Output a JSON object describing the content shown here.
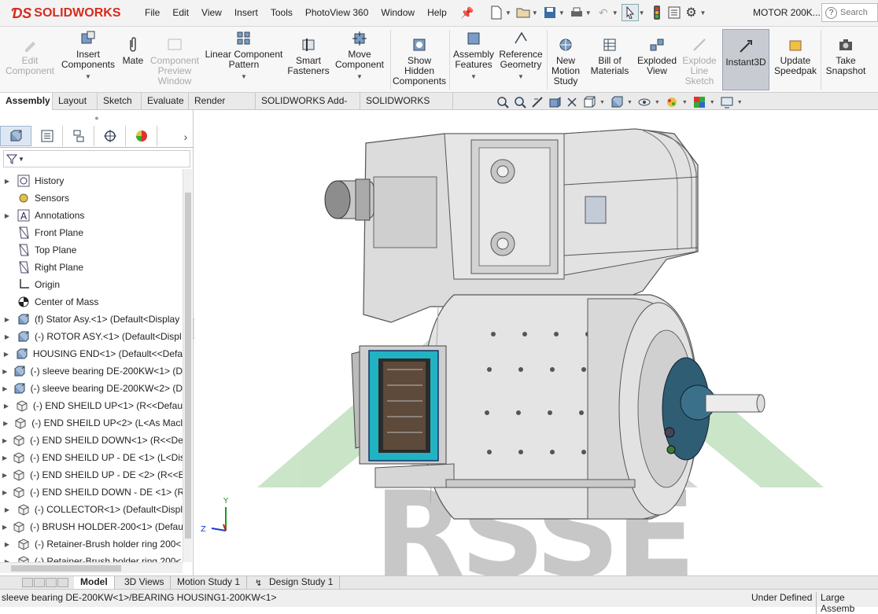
{
  "app": {
    "brand": "SOLIDWORKS",
    "doc_title": "MOTOR 200K...",
    "search_placeholder": "Search"
  },
  "menus": [
    "File",
    "Edit",
    "View",
    "Insert",
    "Tools",
    "PhotoView 360",
    "Window",
    "Help"
  ],
  "ribbon": {
    "edit_component": "Edit Component",
    "insert_components": "Insert Components",
    "mate": "Mate",
    "component_preview": "Component Preview Window",
    "linear_pattern": "Linear Component Pattern",
    "smart_fasteners": "Smart Fasteners",
    "move_component": "Move Component",
    "show_hidden": "Show Hidden Components",
    "assembly_features": "Assembly Features",
    "reference_geometry": "Reference Geometry",
    "new_motion_study": "New Motion Study",
    "bill_of_materials": "Bill of Materials",
    "exploded_view": "Exploded View",
    "explode_line_sketch": "Explode Line Sketch",
    "instant3d": "Instant3D",
    "update_speedpak": "Update Speedpak",
    "take_snapshot": "Take Snapshot"
  },
  "cmd_tabs": [
    "Assembly",
    "Layout",
    "Sketch",
    "Evaluate",
    "Render Tools",
    "SOLIDWORKS Add-Ins",
    "SOLIDWORKS MBD"
  ],
  "tree": [
    {
      "label": "History",
      "expand": true,
      "icon": "history-icon"
    },
    {
      "label": "Sensors",
      "expand": false,
      "icon": "sensors-icon"
    },
    {
      "label": "Annotations",
      "expand": true,
      "icon": "annotations-icon"
    },
    {
      "label": "Front Plane",
      "expand": false,
      "icon": "plane-icon"
    },
    {
      "label": "Top Plane",
      "expand": false,
      "icon": "plane-icon"
    },
    {
      "label": "Right Plane",
      "expand": false,
      "icon": "plane-icon"
    },
    {
      "label": "Origin",
      "expand": false,
      "icon": "origin-icon"
    },
    {
      "label": "Center of Mass",
      "expand": false,
      "icon": "center-of-mass-icon"
    },
    {
      "label": "(f) Stator Asy.<1> (Default<Display",
      "expand": true,
      "icon": "subassembly-icon"
    },
    {
      "label": "(-) ROTOR ASY.<1> (Default<Displ",
      "expand": true,
      "icon": "subassembly-icon"
    },
    {
      "label": "HOUSING END<1> (Default<<Defa",
      "expand": true,
      "icon": "subassembly-icon"
    },
    {
      "label": "(-) sleeve bearing DE-200KW<1> (D",
      "expand": true,
      "icon": "subassembly-icon"
    },
    {
      "label": "(-) sleeve bearing DE-200KW<2> (D",
      "expand": true,
      "icon": "subassembly-icon"
    },
    {
      "label": "(-) END SHEILD UP<1> (R<<Defau",
      "expand": true,
      "icon": "part-icon"
    },
    {
      "label": "(-) END SHEILD UP<2> (L<As Macl",
      "expand": true,
      "icon": "part-icon"
    },
    {
      "label": "(-) END SHEILD DOWN<1> (R<<De",
      "expand": true,
      "icon": "part-icon"
    },
    {
      "label": "(-) END SHEILD UP - DE <1> (L<Dis",
      "expand": true,
      "icon": "part-icon"
    },
    {
      "label": "(-) END SHEILD UP - DE <2> (R<<E",
      "expand": true,
      "icon": "part-icon"
    },
    {
      "label": "(-) END SHEILD DOWN - DE <1> (R",
      "expand": true,
      "icon": "part-icon"
    },
    {
      "label": "(-) COLLECTOR<1> (Default<Displ",
      "expand": true,
      "icon": "part-icon"
    },
    {
      "label": "(-) BRUSH HOLDER-200<1> (Defau",
      "expand": true,
      "icon": "part-icon"
    },
    {
      "label": "(-) Retainer-Brush holder ring 200<",
      "expand": true,
      "icon": "part-icon"
    },
    {
      "label": "(-) Retainer-Brush holder ring 200<",
      "expand": true,
      "icon": "part-icon"
    }
  ],
  "bottom_tabs": [
    "Model",
    "3D Views",
    "Motion Study 1",
    "Design Study 1"
  ],
  "status": {
    "left": "sleeve bearing DE-200KW<1>/BEARING HOUSING1-200KW<1>",
    "state": "Under Defined",
    "mode": "Large Assemb"
  },
  "triad": {
    "y": "Y",
    "z": "Z"
  },
  "watermark": "RSSE"
}
